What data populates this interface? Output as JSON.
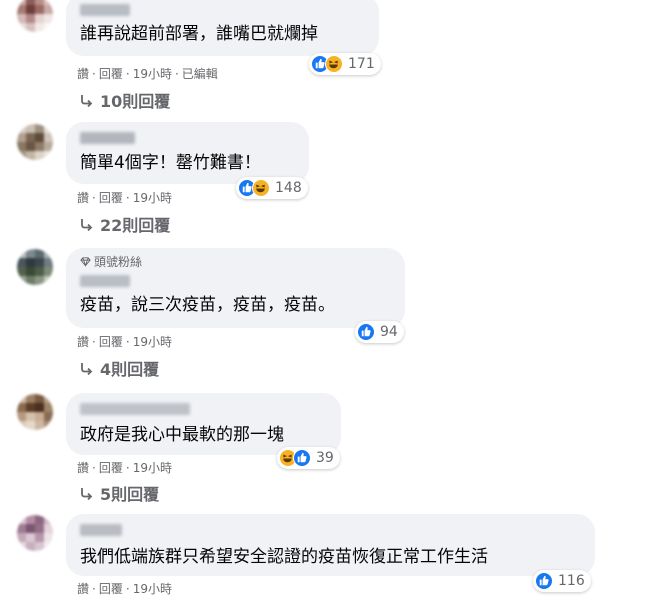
{
  "colors": {
    "bubble": "#f0f2f5",
    "like": "#1877f2",
    "haha": "#f7b125",
    "meta": "#65676b"
  },
  "badges": {
    "top_fan": "頭號粉絲"
  },
  "actions": {
    "like": "讚",
    "reply": "回覆",
    "sep": "·",
    "edited": "已編輯"
  },
  "comments": [
    {
      "text": "誰再說超前部署，誰嘴巴就爛掉",
      "reactions": [
        "like",
        "haha"
      ],
      "count": "171",
      "time": "19小時",
      "edited": true,
      "replies": "10則回覆"
    },
    {
      "text": "簡單4個字！罄竹難書！",
      "reactions": [
        "like",
        "haha"
      ],
      "count": "148",
      "time": "19小時",
      "edited": false,
      "replies": "22則回覆"
    },
    {
      "text": "疫苗，說三次疫苗，疫苗，疫苗。",
      "reactions": [
        "like"
      ],
      "count": "94",
      "time": "19小時",
      "edited": false,
      "replies": "4則回覆",
      "badge": "top_fan"
    },
    {
      "text": "政府是我心中最軟的那一塊",
      "reactions": [
        "haha",
        "like"
      ],
      "count": "39",
      "time": "19小時",
      "edited": false,
      "replies": "5則回覆"
    },
    {
      "text": "我們低端族群只希望安全認證的疫苗恢復正常工作生活",
      "reactions": [
        "like"
      ],
      "count": "116",
      "time": "19小時",
      "edited": false,
      "replies": ""
    }
  ]
}
